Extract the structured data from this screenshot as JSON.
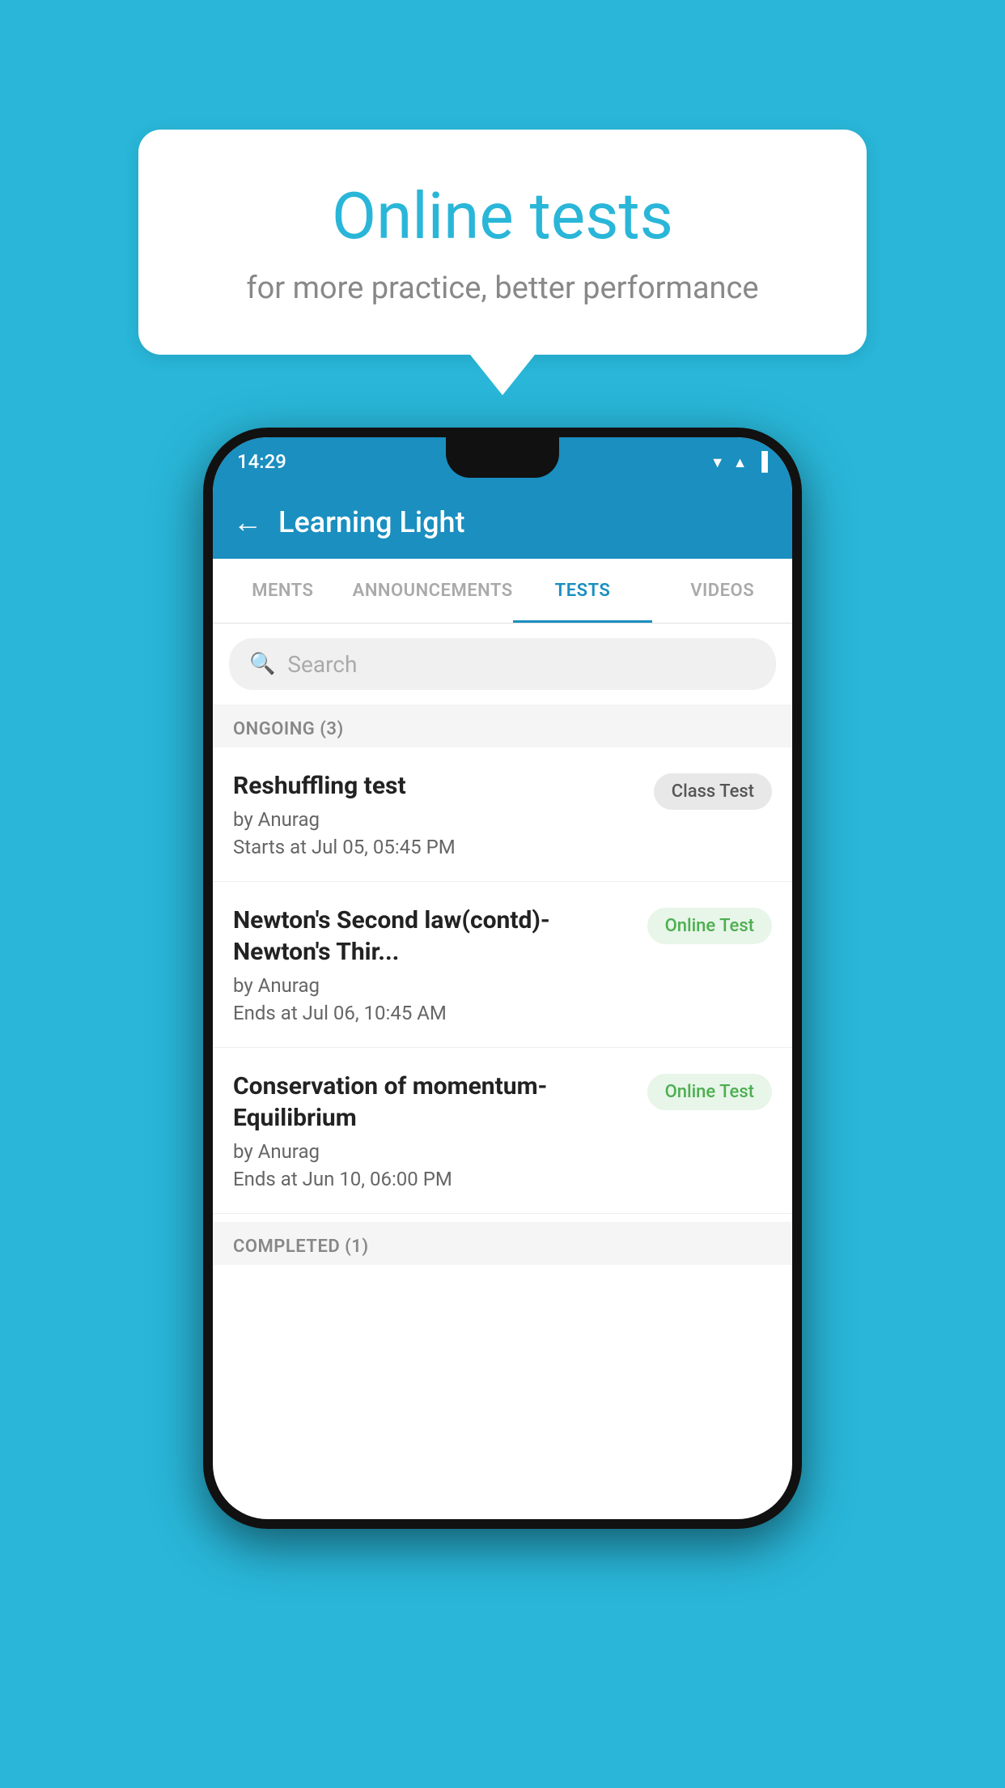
{
  "background": {
    "color": "#29b6d8"
  },
  "speech_bubble": {
    "title": "Online tests",
    "subtitle": "for more practice, better performance"
  },
  "phone": {
    "status_bar": {
      "time": "14:29"
    },
    "app_bar": {
      "title": "Learning Light",
      "back_label": "←"
    },
    "tabs": [
      {
        "label": "MENTS",
        "active": false
      },
      {
        "label": "ANNOUNCEMENTS",
        "active": false
      },
      {
        "label": "TESTS",
        "active": true
      },
      {
        "label": "VIDEOS",
        "active": false
      }
    ],
    "search": {
      "placeholder": "Search"
    },
    "ongoing_section": {
      "header": "ONGOING (3)"
    },
    "tests": [
      {
        "name": "Reshuffling test",
        "author": "by Anurag",
        "time_label": "Starts at",
        "time_value": "Jul 05, 05:45 PM",
        "badge": "Class Test",
        "badge_type": "class"
      },
      {
        "name": "Newton's Second law(contd)-Newton's Thir...",
        "author": "by Anurag",
        "time_label": "Ends at",
        "time_value": "Jul 06, 10:45 AM",
        "badge": "Online Test",
        "badge_type": "online"
      },
      {
        "name": "Conservation of momentum-Equilibrium",
        "author": "by Anurag",
        "time_label": "Ends at",
        "time_value": "Jun 10, 06:00 PM",
        "badge": "Online Test",
        "badge_type": "online"
      }
    ],
    "completed_section": {
      "header": "COMPLETED (1)"
    }
  }
}
